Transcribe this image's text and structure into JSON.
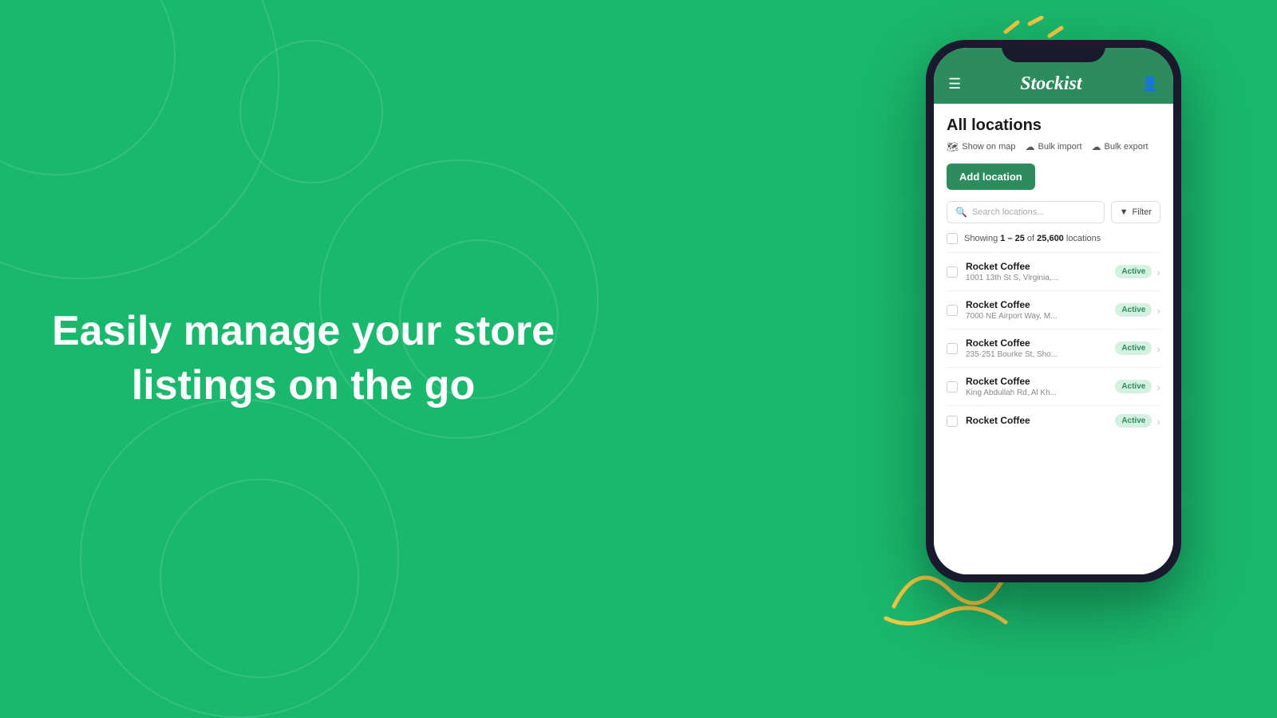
{
  "background": {
    "color": "#1ab86c"
  },
  "hero": {
    "text": "Easily manage your store listings on the go"
  },
  "decorative": {
    "accent_color": "#f5c842"
  },
  "app": {
    "logo": "Stockist",
    "header_title": "All locations",
    "action_links": [
      {
        "icon": "🗺",
        "label": "Show on map"
      },
      {
        "icon": "☁",
        "label": "Bulk import"
      },
      {
        "icon": "☁",
        "label": "Bulk export"
      }
    ],
    "add_button_label": "Add location",
    "search_placeholder": "Search locations...",
    "filter_label": "Filter",
    "showing_text": "Showing ",
    "showing_range": "1 – 25",
    "showing_of": " of ",
    "showing_total": "25,600",
    "showing_suffix": " locations",
    "locations": [
      {
        "name": "Rocket Coffee",
        "address": "1001 13th St S, Virginia,...",
        "status": "Active"
      },
      {
        "name": "Rocket Coffee",
        "address": "7000 NE Airport Way, M...",
        "status": "Active"
      },
      {
        "name": "Rocket Coffee",
        "address": "235-251 Bourke St, Sho...",
        "status": "Active"
      },
      {
        "name": "Rocket Coffee",
        "address": "King Abdullah Rd, Al Kh...",
        "status": "Active"
      },
      {
        "name": "Rocket Coffee",
        "address": "",
        "status": "Active"
      }
    ]
  }
}
